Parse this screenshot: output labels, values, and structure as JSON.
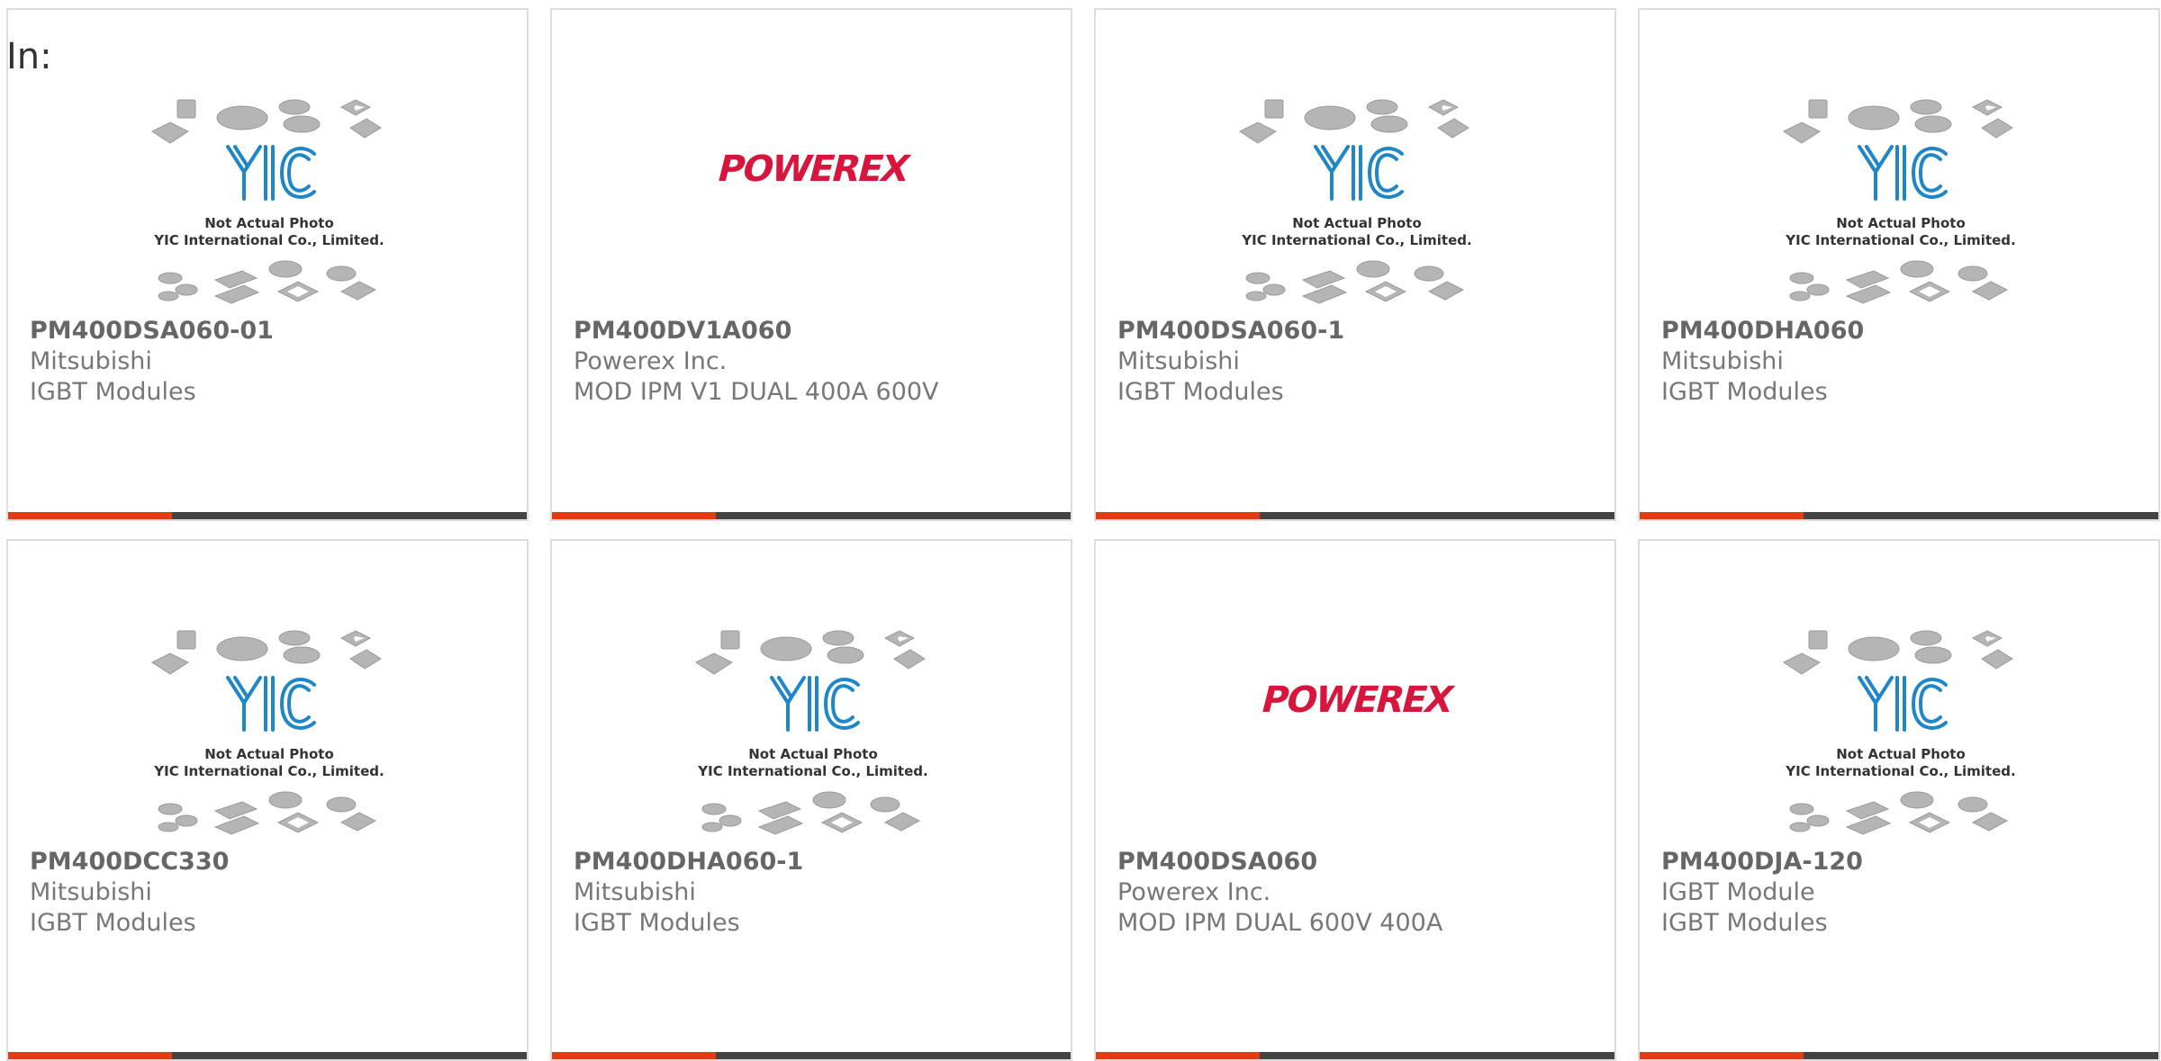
{
  "header": {
    "in_label": "In:"
  },
  "placeholder": {
    "caption_line1": "Not Actual Photo",
    "caption_line2": "YIC International Co., Limited.",
    "logo_text": "YIC"
  },
  "brand_logo": {
    "text": "POWEREX",
    "color": "#d6163d"
  },
  "colors": {
    "accent": "#e13d14",
    "bar": "#444444",
    "yic_blue": "#1f86c8"
  },
  "products": [
    {
      "part": "PM400DSA060-01",
      "manufacturer": "Mitsubishi",
      "description": "IGBT Modules",
      "image": "yic-placeholder"
    },
    {
      "part": "PM400DV1A060",
      "manufacturer": "Powerex Inc.",
      "description": "MOD IPM V1 DUAL 400A 600V",
      "image": "powerex-logo"
    },
    {
      "part": "PM400DSA060-1",
      "manufacturer": "Mitsubishi",
      "description": "IGBT Modules",
      "image": "yic-placeholder"
    },
    {
      "part": "PM400DHA060",
      "manufacturer": "Mitsubishi",
      "description": "IGBT Modules",
      "image": "yic-placeholder"
    },
    {
      "part": "PM400DCC330",
      "manufacturer": "Mitsubishi",
      "description": "IGBT Modules",
      "image": "yic-placeholder"
    },
    {
      "part": "PM400DHA060-1",
      "manufacturer": "Mitsubishi",
      "description": "IGBT Modules",
      "image": "yic-placeholder"
    },
    {
      "part": "PM400DSA060",
      "manufacturer": "Powerex Inc.",
      "description": "MOD IPM DUAL 600V 400A",
      "image": "powerex-logo"
    },
    {
      "part": "PM400DJA-120",
      "manufacturer": "IGBT Module",
      "description": "IGBT Modules",
      "image": "yic-placeholder"
    }
  ]
}
